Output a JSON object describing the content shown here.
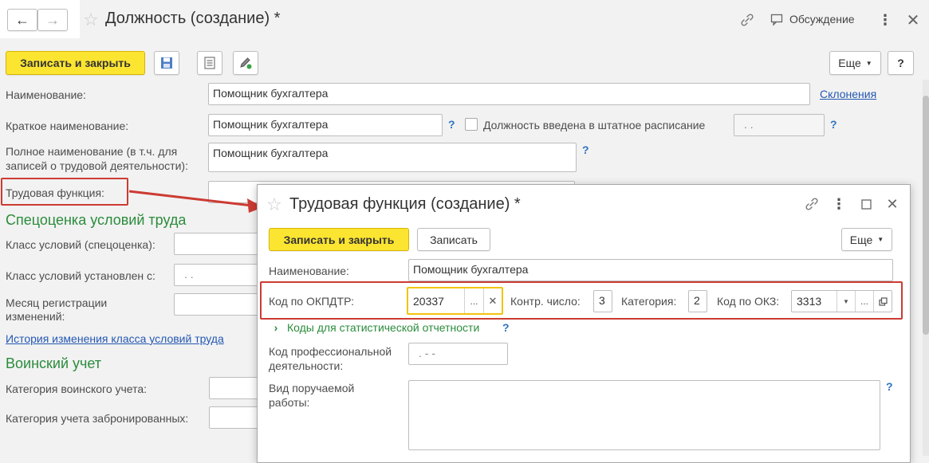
{
  "header": {
    "title": "Должность (создание) *",
    "discussion": "Обсуждение"
  },
  "toolbar": {
    "save_close": "Записать и закрыть",
    "more": "Еще",
    "help": "?"
  },
  "form": {
    "name_label": "Наименование:",
    "name_value": "Помощник бухгалтера",
    "declensions_link": "Склонения",
    "short_label": "Краткое наименование:",
    "short_value": "Помощник бухгалтера",
    "staffing_checkbox": "Должность введена в штатное расписание",
    "staffing_date": ". .",
    "full_label_line1": "Полное наименование (в т.ч. для",
    "full_label_line2": "записей о трудовой деятельности):",
    "full_value": "Помощник бухгалтера",
    "labor_function_label": "Трудовая функция:",
    "section_special": "Спецоценка условий труда",
    "class_label": "Класс условий (спецоценка):",
    "class_since_label": "Класс условий установлен с:",
    "class_since_value": ". .",
    "month_label_line1": "Месяц регистрации",
    "month_label_line2": "изменений:",
    "history_link": "История изменения класса условий труда",
    "section_military": "Воинский учет",
    "military_cat_label": "Категория воинского учета:",
    "reserved_cat_label": "Категория учета забронированных:"
  },
  "dialog": {
    "title": "Трудовая функция (создание) *",
    "save_close": "Записать и закрыть",
    "save": "Записать",
    "more": "Еще",
    "name_label": "Наименование:",
    "name_value": "Помощник бухгалтера",
    "okpdtr_label": "Код по ОКПДТР:",
    "okpdtr_value": "20337",
    "control_label": "Контр. число:",
    "control_value": "3",
    "category_label": "Категория:",
    "category_value": "2",
    "okz_label": "Код по ОКЗ:",
    "okz_value": "3313",
    "stat_codes": "Коды для статистической отчетности",
    "prof_label_line1": "Код профессиональной",
    "prof_label_line2": "деятельности:",
    "prof_value": ".  - -",
    "work_label_line1": "Вид поручаемой",
    "work_label_line2": "работы:"
  },
  "colors": {
    "accent_yellow": "#fce531",
    "section_green": "#2b8c3c",
    "link_blue": "#2458b3",
    "highlight_red": "#cc3b33",
    "focus_yellow": "#f1c40f"
  }
}
